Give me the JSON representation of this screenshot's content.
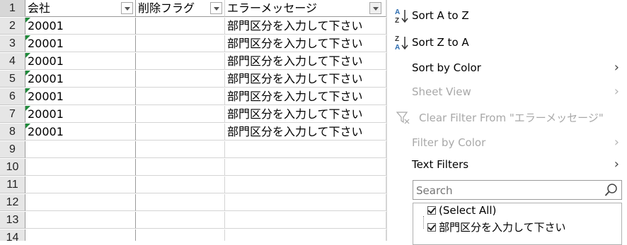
{
  "sheet": {
    "row_numbers": [
      "1",
      "2",
      "3",
      "4",
      "5",
      "6",
      "7",
      "8",
      "9",
      "10",
      "11",
      "12",
      "13",
      "14"
    ],
    "headers": [
      "会社",
      "削除フラグ",
      "エラーメッセージ"
    ],
    "rows": [
      [
        "20001",
        "",
        "部門区分を入力して下さい"
      ],
      [
        "20001",
        "",
        "部門区分を入力して下さい"
      ],
      [
        "20001",
        "",
        "部門区分を入力して下さい"
      ],
      [
        "20001",
        "",
        "部門区分を入力して下さい"
      ],
      [
        "20001",
        "",
        "部門区分を入力して下さい"
      ],
      [
        "20001",
        "",
        "部門区分を入力して下さい"
      ],
      [
        "20001",
        "",
        "部門区分を入力して下さい"
      ]
    ]
  },
  "menu": {
    "sort_az": "Sort A to Z",
    "sort_za": "Sort Z to A",
    "sort_by_color": "Sort by Color",
    "sheet_view": "Sheet View",
    "clear_filter": "Clear Filter From \"エラーメッセージ\"",
    "filter_by_color": "Filter by Color",
    "text_filters": "Text Filters",
    "search_placeholder": "Search",
    "select_all": "(Select All)",
    "item1": "部門区分を入力して下さい"
  },
  "colors": {
    "flag": "#1f8a3a",
    "accent_blue": "#2b6cb0",
    "disabled": "#a8a8a8"
  }
}
